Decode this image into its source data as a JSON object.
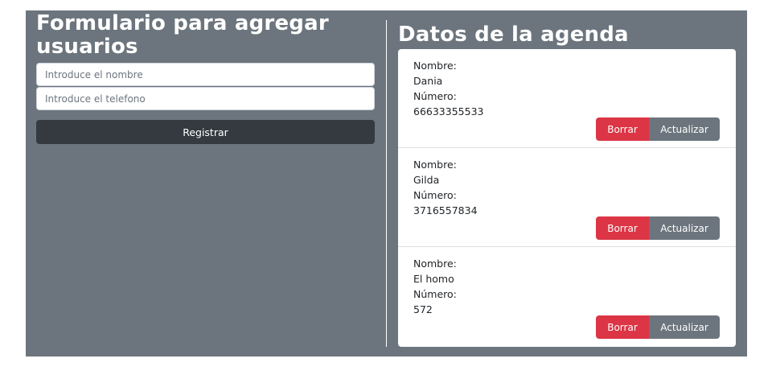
{
  "form": {
    "title": "Formulario para agregar usuarios",
    "name_placeholder": "Introduce el nombre",
    "phone_placeholder": "Introduce el telefono",
    "register_label": "Registrar"
  },
  "agenda": {
    "title": "Datos de la agenda",
    "contacts": [
      {
        "name_label": "Nombre:",
        "name": "Dania",
        "number_label": "Número:",
        "number": "66633355533",
        "delete_label": "Borrar",
        "update_label": "Actualizar"
      },
      {
        "name_label": "Nombre:",
        "name": "Gilda",
        "number_label": "Número:",
        "number": "3716557834",
        "delete_label": "Borrar",
        "update_label": "Actualizar"
      },
      {
        "name_label": "Nombre:",
        "name": "El homo",
        "number_label": "Número:",
        "number": "572",
        "delete_label": "Borrar",
        "update_label": "Actualizar"
      }
    ]
  },
  "colors": {
    "panel_bg": "#6c757d",
    "register_bg": "#343a40",
    "delete_bg": "#dc3545",
    "update_bg": "#6c757d"
  }
}
